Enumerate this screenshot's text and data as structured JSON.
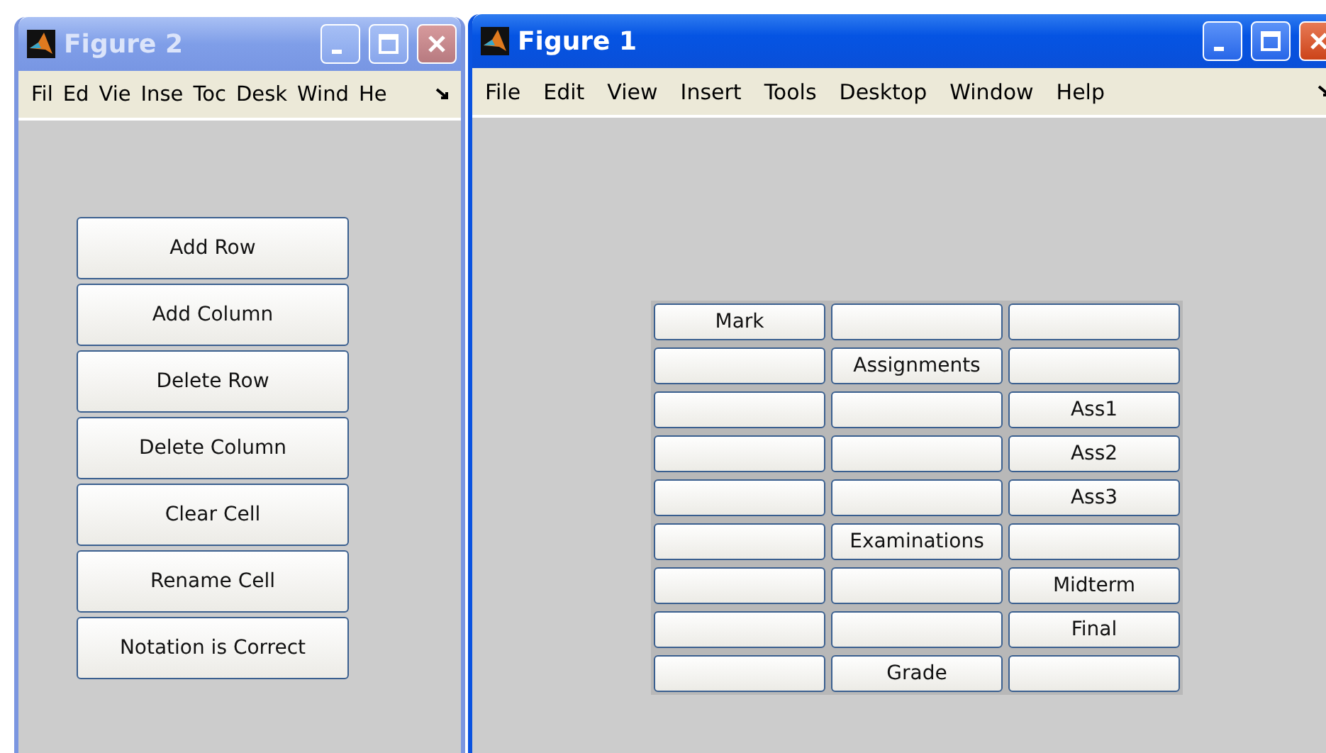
{
  "windows": [
    {
      "title": "Figure 2",
      "active": false,
      "menu": [
        "Fil",
        "Ed",
        "Vie",
        "Inse",
        "Toc",
        "Desk",
        "Wind",
        "He"
      ],
      "kind": "buttons",
      "buttons": [
        "Add Row",
        "Add Column",
        "Delete Row",
        "Delete Column",
        "Clear Cell",
        "Rename Cell",
        "Notation is Correct"
      ]
    },
    {
      "title": "Figure 1",
      "active": true,
      "menu": [
        "File",
        "Edit",
        "View",
        "Insert",
        "Tools",
        "Desktop",
        "Window",
        "Help"
      ],
      "kind": "grid",
      "rows": [
        {
          "cells": [
            {
              "label": "Mark"
            },
            {},
            {}
          ]
        },
        {
          "cells": [
            {},
            {
              "label": "Assignments"
            },
            {}
          ]
        },
        {
          "cells": [
            {},
            {},
            {
              "label": "Ass1"
            }
          ]
        },
        {
          "cells": [
            {},
            {},
            {
              "label": "Ass2"
            }
          ]
        },
        {
          "cells": [
            {},
            {},
            {
              "label": "Ass3"
            }
          ]
        },
        {
          "cells": [
            {},
            {
              "label": "Examinations"
            },
            {}
          ]
        },
        {
          "cells": [
            {},
            {},
            {
              "label": "Midterm"
            }
          ]
        },
        {
          "cells": [
            {},
            {},
            {
              "label": "Final"
            }
          ]
        },
        {
          "cells": [
            {},
            {
              "label": "Grade"
            },
            {}
          ]
        }
      ]
    }
  ]
}
